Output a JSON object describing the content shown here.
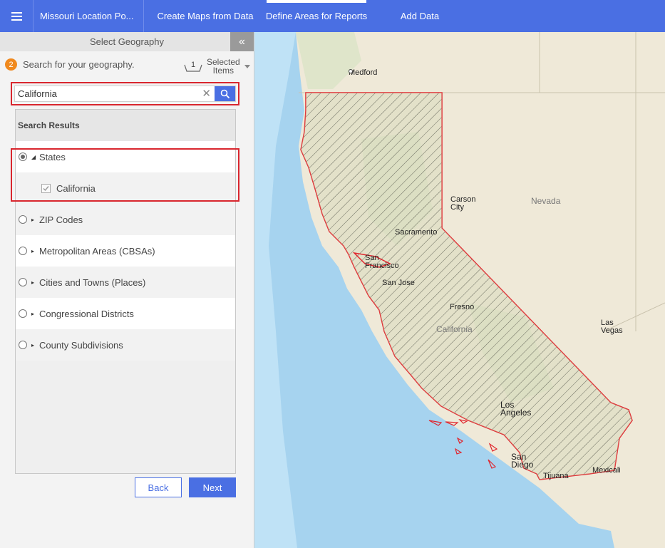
{
  "topbar": {
    "app_title": "Missouri Location Po...",
    "tabs": [
      "Create Maps from Data",
      "Define Areas for Reports",
      "Add Data"
    ],
    "active_tab": "Define Areas for Reports"
  },
  "panel": {
    "title": "Select Geography",
    "step_number": "2",
    "step_text": "Search for your geography.",
    "selected_count": "1",
    "selected_label_1": "Selected",
    "selected_label_2": "Items",
    "search": {
      "value": "California"
    },
    "results_header": "Search Results",
    "results": [
      {
        "label": "States",
        "expanded": true,
        "selected": true,
        "children": [
          {
            "label": "California",
            "checked": true
          }
        ]
      },
      {
        "label": "ZIP Codes"
      },
      {
        "label": "Metropolitan Areas (CBSAs)"
      },
      {
        "label": "Cities and Towns (Places)"
      },
      {
        "label": "Congressional Districts"
      },
      {
        "label": "County Subdivisions"
      }
    ],
    "back_label": "Back",
    "next_label": "Next"
  },
  "map": {
    "cities": {
      "medford": "Medford",
      "carson_city_1": "Carson",
      "carson_city_2": "City",
      "sacramento": "Sacramento",
      "san_francisco_1": "San",
      "san_francisco_2": "Francisco",
      "san_jose": "San Jose",
      "fresno": "Fresno",
      "las_vegas_1": "Las",
      "las_vegas_2": "Vegas",
      "los_angeles_1": "Los",
      "los_angeles_2": "Angeles",
      "san_diego_1": "San",
      "san_diego_2": "Diego",
      "tijuana": "Tijuana",
      "mexicali": "Mexicali"
    },
    "state_labels": {
      "nevada": "Nevada",
      "california": "California"
    },
    "colors": {
      "ocean": "#a6d3ef",
      "land": "#efe9d8",
      "selection": "#e0262e",
      "accent": "#4a6fe3"
    }
  }
}
